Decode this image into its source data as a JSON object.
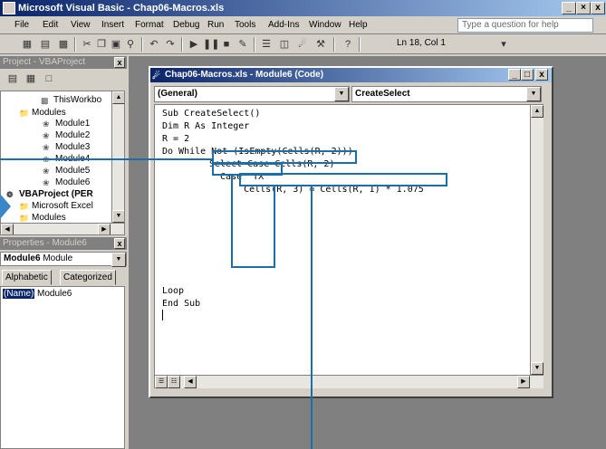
{
  "window": {
    "title": "Microsoft Visual Basic - Chap06-Macros.xls",
    "min": "_",
    "max": "×",
    "close": "x"
  },
  "menu": {
    "items": [
      "File",
      "Edit",
      "View",
      "Insert",
      "Format",
      "Debug",
      "Run",
      "Tools",
      "Add-Ins",
      "Window",
      "Help"
    ],
    "ask_placeholder": "Type a question for help"
  },
  "toolbar": {
    "position": "Ln 18, Col 1"
  },
  "project": {
    "caption": "Project - VBAProject",
    "items": [
      {
        "label": "ThisWorkbo"
      },
      {
        "label": "Modules"
      },
      {
        "label": "Module1"
      },
      {
        "label": "Module2"
      },
      {
        "label": "Module3"
      },
      {
        "label": "Module4"
      },
      {
        "label": "Module5"
      },
      {
        "label": "Module6"
      },
      {
        "label": "VBAProject (PER"
      },
      {
        "label": "Microsoft Excel"
      },
      {
        "label": "Modules"
      }
    ]
  },
  "properties": {
    "caption": "Properties - Module6",
    "object_name": "Module6",
    "object_type": "Module",
    "tab_alpha": "Alphabetic",
    "tab_cat": "Categorized",
    "prop_name": "(Name)",
    "prop_value": "Module6"
  },
  "code_window": {
    "caption": "Chap06-Macros.xls - Module6 (Code)",
    "object_dd": "(General)",
    "proc_dd": "CreateSelect",
    "lines": [
      "Sub CreateSelect()",
      "Dim R As Integer",
      "R = 2",
      "Do While Not (IsEmpty(Cells(R, 2)))",
      "Select Case Cells(R, 2)",
      "  Case \"TX\"",
      "    Cells(R, 3) = Cells(R, 1) * 1.075",
      "Loop",
      "End Sub"
    ]
  },
  "colors": {
    "accent": "#1a6fa8",
    "title_start": "#0a246a",
    "title_end": "#a6caf0"
  }
}
